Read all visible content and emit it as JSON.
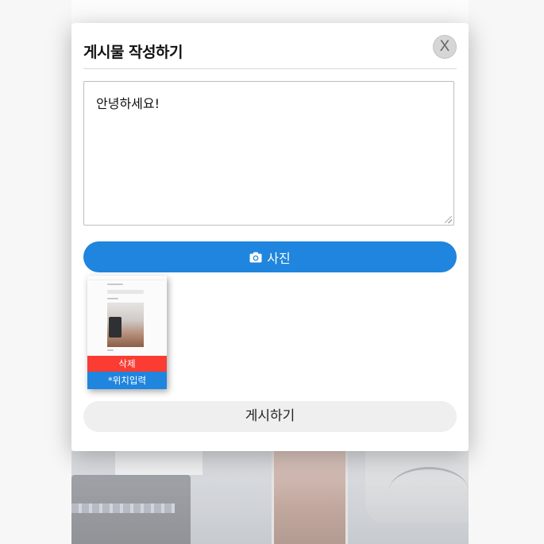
{
  "modal": {
    "title": "게시물 작성하기",
    "close_label": "X",
    "textarea_value": "안녕하세요!",
    "photo_button_label": "사진",
    "photo_icon": "camera-icon",
    "thumbnail": {
      "delete_label": "삭제",
      "location_label": "*위치입력"
    },
    "post_button_label": "게시하기"
  },
  "colors": {
    "accent_blue": "#1f85de",
    "delete_red": "#fa3c33",
    "post_button_bg": "#efefef"
  }
}
